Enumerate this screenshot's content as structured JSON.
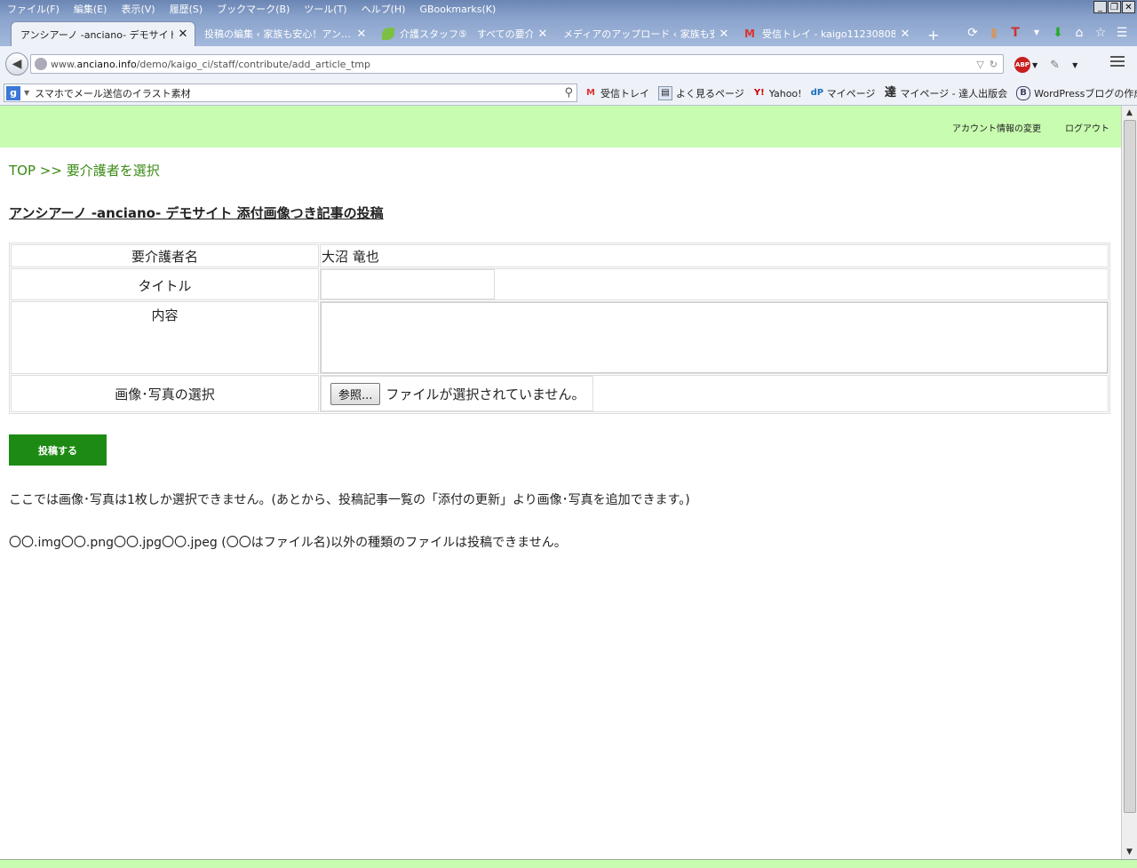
{
  "menubar": {
    "items": [
      "ファイル(F)",
      "編集(E)",
      "表示(V)",
      "履歴(S)",
      "ブックマーク(B)",
      "ツール(T)",
      "ヘルプ(H)",
      "GBookmarks(K)"
    ]
  },
  "tabs": [
    {
      "title": "アンシアーノ -anciano- デモサイト…",
      "active": true
    },
    {
      "title": "投稿の編集 ‹ 家族も安心！アン…",
      "active": false
    },
    {
      "title": "介護スタッフ⑤　すべての要介…",
      "active": false
    },
    {
      "title": "メディアのアップロード ‹ 家族も安…",
      "active": false
    },
    {
      "title": "受信トレイ - kaigo11230808…",
      "active": false
    }
  ],
  "navbar": {
    "url_prefix": "www.",
    "url_host": "anciano.info",
    "url_path": "/demo/kaigo_ci/staff/contribute/add_article_tmp",
    "abp": "ABP"
  },
  "search": {
    "value": "スマホでメール送信のイラスト素材"
  },
  "bookmarks": [
    {
      "label": "受信トレイ",
      "icon": "gmail-icon"
    },
    {
      "label": "よく見るページ",
      "icon": "page-icon"
    },
    {
      "label": "Yahoo!",
      "icon": "yahoo-icon"
    },
    {
      "label": "マイページ",
      "icon": "mypage-icon"
    },
    {
      "label": "マイページ - 達人出版会",
      "icon": "tatsujin-icon"
    },
    {
      "label": "WordPressブログの作成…",
      "icon": "wordpress-icon"
    }
  ],
  "header": {
    "account_link": "アカウント情報の変更",
    "logout_link": "ログアウト",
    "bg_color": "#c8fcb0"
  },
  "breadcrumb": {
    "top": "TOP",
    "sep": ">>",
    "current": "要介護者を選択"
  },
  "page_title": "アンシアーノ -anciano- デモサイト 添付画像つき記事の投稿",
  "form": {
    "rows": [
      {
        "label": "要介護者名",
        "value": "大沼 竜也"
      },
      {
        "label": "タイトル",
        "value": ""
      },
      {
        "label": "内容",
        "value": ""
      },
      {
        "label": "画像･写真の選択",
        "value": ""
      }
    ],
    "browse_label": "参照...",
    "file_status": "ファイルが選択されていません。",
    "submit_label": "投稿する"
  },
  "notes": [
    "ここでは画像･写真は1枚しか選択できません。(あとから、投稿記事一覧の「添付の更新」より画像･写真を追加できます。)",
    "〇〇.img〇〇.png〇〇.jpg〇〇.jpeg (〇〇はファイル名)以外の種類のファイルは投稿できません。"
  ]
}
